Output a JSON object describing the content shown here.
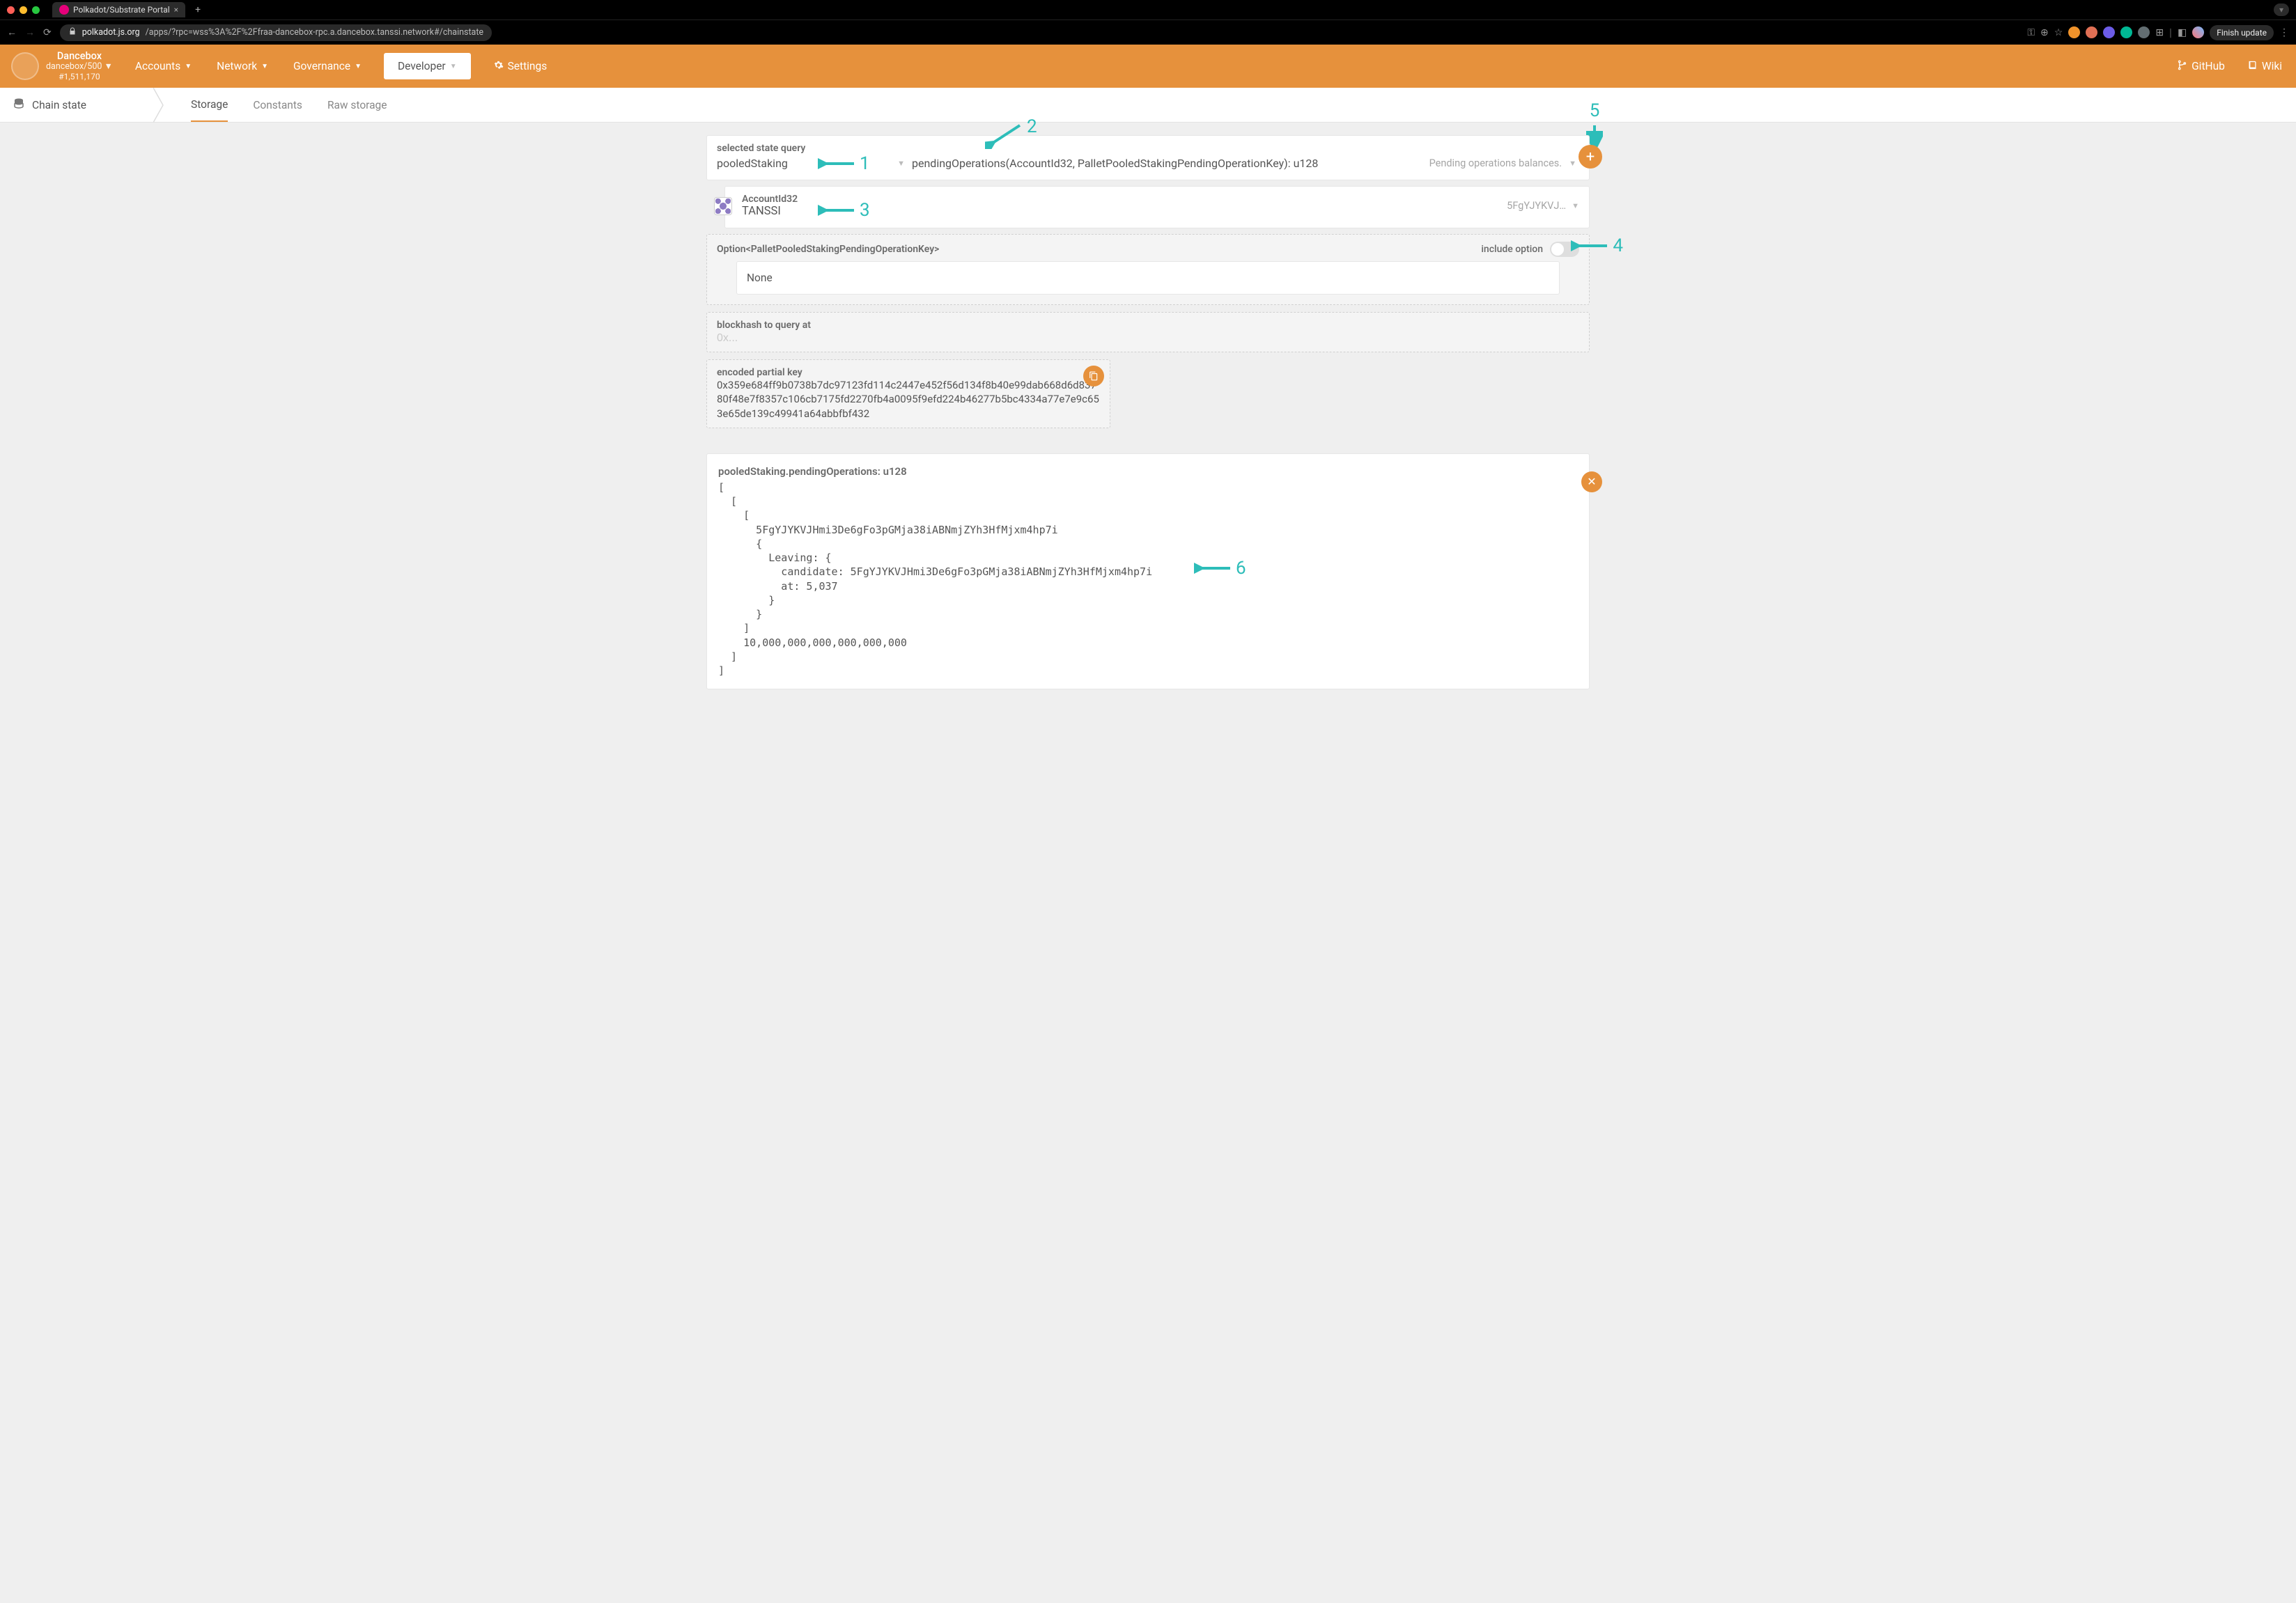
{
  "browser": {
    "tab_title": "Polkadot/Substrate Portal",
    "url_host": "polkadot.js.org",
    "url_path": "/apps/?rpc=wss%3A%2F%2Ffraa-dancebox-rpc.a.dancebox.tanssi.network#/chainstate",
    "finish_update": "Finish update"
  },
  "chain": {
    "name": "Dancebox",
    "sub": "dancebox/500",
    "block": "#1,511,170"
  },
  "nav": {
    "items": [
      "Accounts",
      "Network",
      "Governance",
      "Developer",
      "Settings"
    ],
    "active": "Developer",
    "right": [
      {
        "icon": "branch",
        "label": "GitHub"
      },
      {
        "icon": "book",
        "label": "Wiki"
      }
    ]
  },
  "subnav": {
    "title": "Chain state",
    "tabs": [
      "Storage",
      "Constants",
      "Raw storage"
    ],
    "active": "Storage"
  },
  "query": {
    "section_label": "selected state query",
    "pallet": "pooledStaking",
    "method": "pendingOperations(AccountId32, PalletPooledStakingPendingOperationKey): u128",
    "method_docs": "Pending operations balances."
  },
  "account": {
    "label": "AccountId32",
    "name": "TANSSI",
    "short": "5FgYJYKVJ…"
  },
  "option": {
    "type_label": "Option<PalletPooledStakingPendingOperationKey>",
    "toggle_label": "include option",
    "enabled": false,
    "value": "None"
  },
  "blockhash": {
    "label": "blockhash to query at",
    "placeholder": "0x..."
  },
  "encoded": {
    "label": "encoded partial key",
    "value": "0x359e684ff9b0738b7dc97123fd114c2447e452f56d134f8b40e99dab668d6d83780f48e7f8357c106cb7175fd2270fb4a0095f9efd224b46277b5bc4334a77e7e9c653e65de139c49941a64abbfbf432"
  },
  "result": {
    "title": "pooledStaking.pendingOperations: u128",
    "body": "[\n  [\n    [\n      5FgYJYKVJHmi3De6gFo3pGMja38iABNmjZYh3HfMjxm4hp7i\n      {\n        Leaving: {\n          candidate: 5FgYJYKVJHmi3De6gFo3pGMja38iABNmjZYh3HfMjxm4hp7i\n          at: 5,037\n        }\n      }\n    ]\n    10,000,000,000,000,000,000\n  ]\n]"
  },
  "annotations": {
    "n1": "1",
    "n2": "2",
    "n3": "3",
    "n4": "4",
    "n5": "5",
    "n6": "6"
  }
}
